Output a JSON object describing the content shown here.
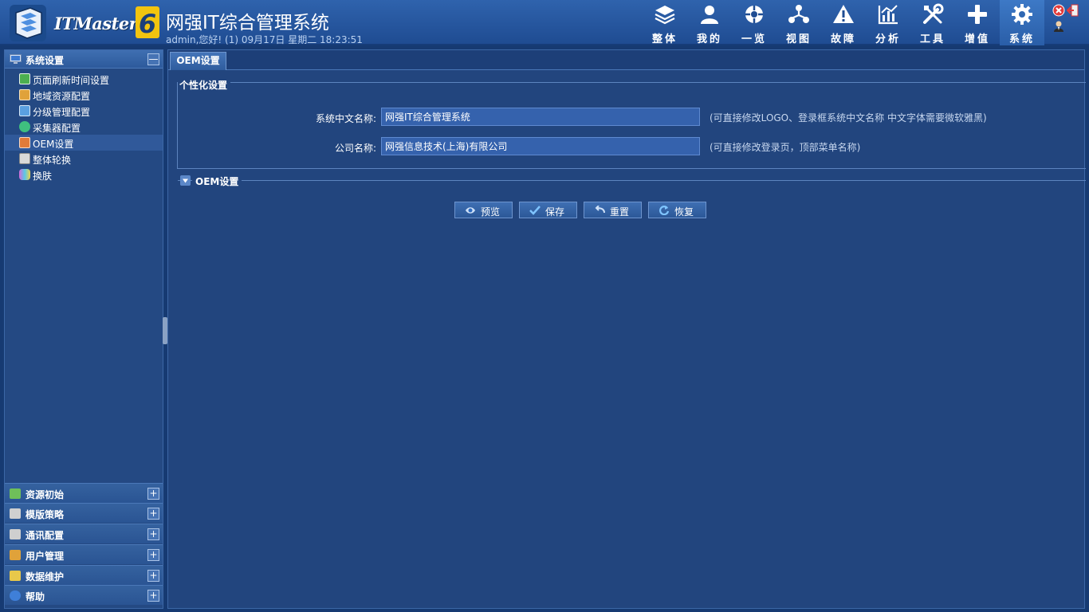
{
  "header": {
    "logo_text": "ITMaster",
    "logo_version": "6",
    "title": "网强IT综合管理系统",
    "subtitle": "admin,您好! (1) 09月17日 星期二 18:23:51"
  },
  "nav": [
    {
      "label": "整体",
      "icon": "layers-icon"
    },
    {
      "label": "我的",
      "icon": "user-icon"
    },
    {
      "label": "一览",
      "icon": "overview-icon"
    },
    {
      "label": "视图",
      "icon": "topology-icon"
    },
    {
      "label": "故障",
      "icon": "warning-icon"
    },
    {
      "label": "分析",
      "icon": "chart-icon"
    },
    {
      "label": "工具",
      "icon": "tools-icon"
    },
    {
      "label": "增值",
      "icon": "plus-icon"
    },
    {
      "label": "系统",
      "icon": "gear-icon",
      "active": true
    }
  ],
  "sidebar": {
    "section_title": "系统设置",
    "collapse_symbol": "—",
    "items": [
      {
        "label": "页面刷新时间设置",
        "icon_color": "#4caf50"
      },
      {
        "label": "地域资源配置",
        "icon_color": "#e0a23a"
      },
      {
        "label": "分级管理配置",
        "icon_color": "#5aa0e0"
      },
      {
        "label": "采集器配置",
        "icon_color": "#3fbf7f"
      },
      {
        "label": "OEM设置",
        "icon_color": "#e07b3a",
        "selected": true
      },
      {
        "label": "整体轮换",
        "icon_color": "#d9d9d9"
      },
      {
        "label": "换肤",
        "icon_color": "#d46ad9"
      }
    ],
    "collapsed_sections": [
      {
        "title": "资源初始",
        "icon_color": "#6fbf5a"
      },
      {
        "title": "模版策略",
        "icon_color": "#d0d0d0"
      },
      {
        "title": "通讯配置",
        "icon_color": "#cfcfcf"
      },
      {
        "title": "用户管理",
        "icon_color": "#e0a23a"
      },
      {
        "title": "数据维护",
        "icon_color": "#e8c84a"
      },
      {
        "title": "帮助",
        "icon_color": "#3f7fd8"
      }
    ],
    "expand_symbol": "+"
  },
  "main": {
    "tab_label": "OEM设置",
    "personal_legend": "个性化设置",
    "fields": {
      "cn_name_label": "系统中文名称:",
      "cn_name_value": "网强IT综合管理系统",
      "cn_name_hint": "(可直接修改LOGO、登录框系统中文名称 中文字体需要微软雅黑)",
      "company_label": "公司名称:",
      "company_value": "网强信息技术(上海)有限公司",
      "company_hint": "(可直接修改登录页，顶部菜单名称)"
    },
    "oem_legend": "OEM设置",
    "buttons": {
      "preview": "预览",
      "save": "保存",
      "reset": "重置",
      "restore": "恢复"
    }
  }
}
